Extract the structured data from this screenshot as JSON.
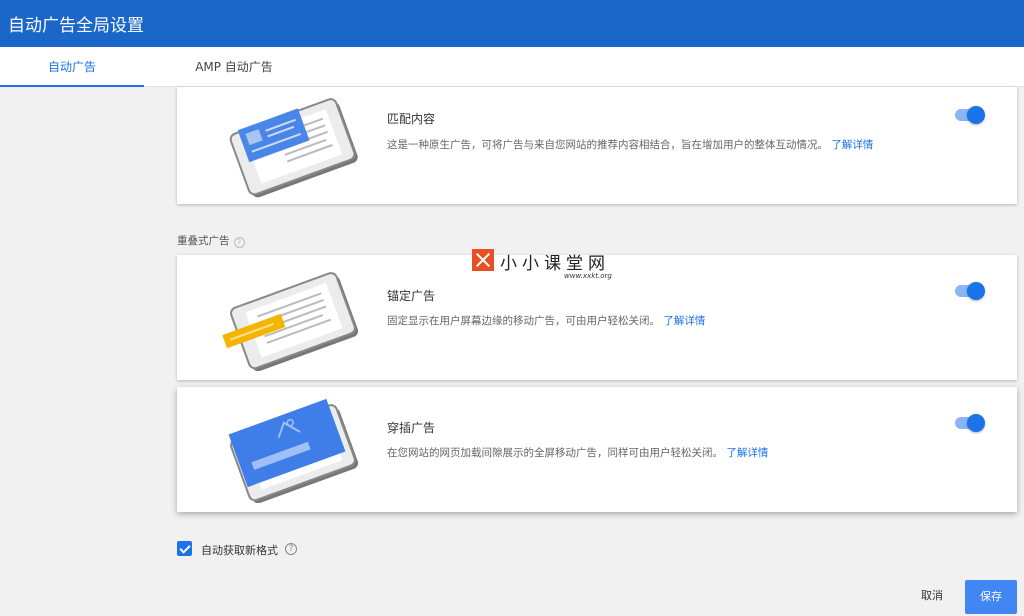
{
  "header": {
    "title": "自动广告全局设置"
  },
  "tabs": [
    {
      "label": "自动广告",
      "active": true
    },
    {
      "label": "AMP 自动广告",
      "active": false
    }
  ],
  "cards": [
    {
      "name": "匹配内容",
      "description": "这是一种原生广告，可将广告与来自您网站的推荐内容相结合，旨在增加用户的整体互动情况。",
      "link": "了解详情",
      "enabled": true
    },
    {
      "name": "锚定广告",
      "description": "固定显示在用户屏幕边缘的移动广告，可由用户轻松关闭。",
      "link": "了解详情",
      "enabled": true
    },
    {
      "name": "穿插广告",
      "description": "在您网站的网页加载间隙展示的全屏移动广告，同样可由用户轻松关闭。",
      "link": "了解详情",
      "enabled": true
    }
  ],
  "section": {
    "label": "重叠式广告",
    "help_glyph": "?"
  },
  "watermark": {
    "text": "小小课堂网",
    "sub": "www.xxkt.org"
  },
  "auto_format": {
    "label": "自动获取新格式",
    "checked": true,
    "help_glyph": "?"
  },
  "footer": {
    "cancel_label": "取消",
    "save_label": "保存"
  },
  "colors": {
    "header": "#1a67c9",
    "accent": "#1a73e8",
    "save_button": "#4285f4",
    "toggle_track": "#8ab4f8"
  }
}
